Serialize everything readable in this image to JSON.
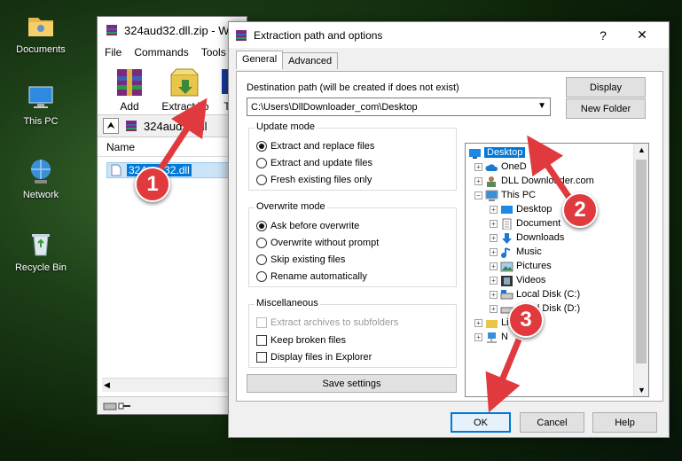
{
  "desktop": {
    "icons": [
      {
        "label": "Documents",
        "icon": "folder-icon"
      },
      {
        "label": "This PC",
        "icon": "computer-icon"
      },
      {
        "label": "Network",
        "icon": "network-icon"
      },
      {
        "label": "Recycle Bin",
        "icon": "recycle-bin-icon"
      }
    ]
  },
  "winrar": {
    "title": "324aud32.dll.zip - W",
    "menu": [
      "File",
      "Commands",
      "Tools"
    ],
    "toolbar": {
      "add": "Add",
      "extract_to": "Extract To",
      "third": "T"
    },
    "path": "324aud32.dl",
    "column_name": "Name",
    "file": "324aud32.dll"
  },
  "dialog": {
    "title": "Extraction path and options",
    "help": "?",
    "close": "✕",
    "tabs": [
      "General",
      "Advanced"
    ],
    "dest_label": "Destination path (will be created if does not exist)",
    "dest_value": "C:\\Users\\DllDownloader_com\\Desktop",
    "display_btn": "Display",
    "new_folder_btn": "New Folder",
    "update_mode": {
      "title": "Update mode",
      "options": [
        "Extract and replace files",
        "Extract and update files",
        "Fresh existing files only"
      ],
      "selected": 0
    },
    "overwrite_mode": {
      "title": "Overwrite mode",
      "options": [
        "Ask before overwrite",
        "Overwrite without prompt",
        "Skip existing files",
        "Rename automatically"
      ],
      "selected": 0
    },
    "misc": {
      "title": "Miscellaneous",
      "options": [
        "Extract archives to subfolders",
        "Keep broken files",
        "Display files in Explorer"
      ]
    },
    "save_settings": "Save settings",
    "tree": {
      "desktop": "Desktop",
      "onedrive": "OneD",
      "dll": "DLL Downloader.com",
      "thispc": "This PC",
      "pc_desktop": "Desktop",
      "documents": "Document",
      "downloads": "Downloads",
      "music": "Music",
      "pictures": "Pictures",
      "videos": "Videos",
      "local_c": "Local Disk (C:)",
      "local_d": "Local Disk (D:)",
      "libraries": "Lib",
      "network": "N"
    },
    "ok": "OK",
    "cancel": "Cancel",
    "helpbtn": "Help"
  },
  "annotations": [
    "1",
    "2",
    "3"
  ],
  "colors": {
    "accent": "#0078d7",
    "annotation": "#e03a3e"
  }
}
